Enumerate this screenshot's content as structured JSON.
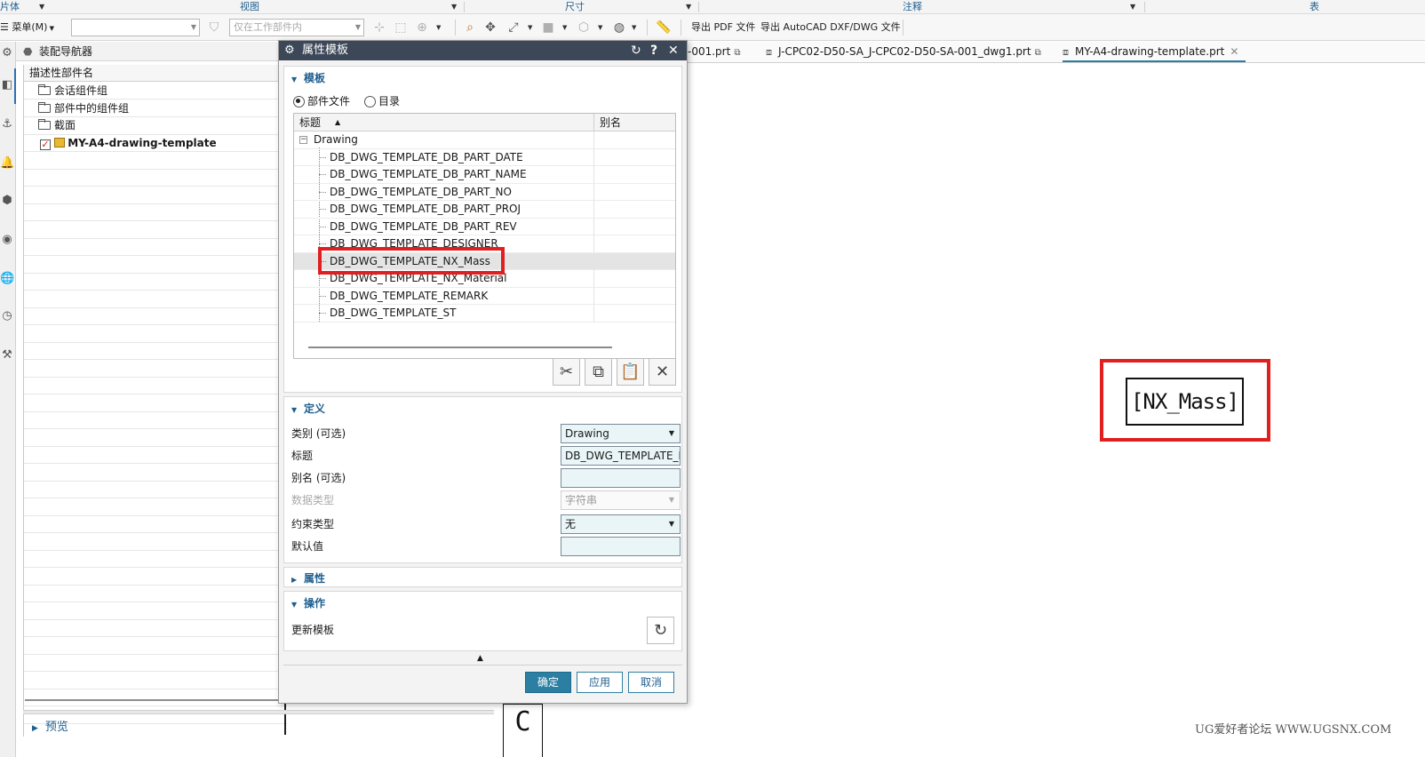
{
  "ribbon_groups": [
    {
      "label": "片体"
    },
    {
      "label": "视图"
    },
    {
      "label": "尺寸"
    },
    {
      "label": "注释"
    },
    {
      "label": "表"
    }
  ],
  "toolbar": {
    "menu_label": "菜单(M)",
    "combo1_value": "",
    "combo2_placeholder": "仅在工作部件内",
    "export_pdf": "导出 PDF 文件",
    "export_dwg": "导出 AutoCAD DXF/DWG 文件"
  },
  "navigator": {
    "title": "装配导航器",
    "column_header": "描述性部件名",
    "items": [
      {
        "label": "会话组件组"
      },
      {
        "label": "部件中的组件组"
      },
      {
        "label": "截面"
      },
      {
        "label": "MY-A4-drawing-template"
      }
    ],
    "preview_label": "预览"
  },
  "dialog": {
    "title": "属性模板",
    "sections": {
      "template": "模板",
      "definition": "定义",
      "attributes": "属性",
      "operations": "操作"
    },
    "radio_part_file": "部件文件",
    "radio_directory": "目录",
    "grid": {
      "col_title": "标题",
      "col_alias": "别名",
      "root": "Drawing",
      "rows": [
        "DB_DWG_TEMPLATE_DB_PART_DATE",
        "DB_DWG_TEMPLATE_DB_PART_NAME",
        "DB_DWG_TEMPLATE_DB_PART_NO",
        "DB_DWG_TEMPLATE_DB_PART_PROJ",
        "DB_DWG_TEMPLATE_DB_PART_REV",
        "DB_DWG_TEMPLATE_DESIGNER",
        "DB_DWG_TEMPLATE_NX_Mass",
        "DB_DWG_TEMPLATE_NX_Material",
        "DB_DWG_TEMPLATE_REMARK",
        "DB_DWG_TEMPLATE_ST"
      ],
      "selected_row": "DB_DWG_TEMPLATE_NX_Mass"
    },
    "fields": {
      "category_label": "类别 (可选)",
      "category_value": "Drawing",
      "title_label": "标题",
      "title_value": "DB_DWG_TEMPLATE_N",
      "alias_label": "别名 (可选)",
      "alias_value": "",
      "datatype_label": "数据类型",
      "datatype_value": "字符串",
      "constraint_label": "约束类型",
      "constraint_value": "无",
      "default_label": "默认值",
      "default_value": ""
    },
    "update_template_label": "更新模板",
    "buttons": {
      "ok": "确定",
      "apply": "应用",
      "cancel": "取消"
    }
  },
  "doc_tabs": [
    {
      "label": "-001.prt"
    },
    {
      "label": "J-CPC02-D50-SA_J-CPC02-D50-SA-001_dwg1.prt"
    },
    {
      "label": "MY-A4-drawing-template.prt",
      "active": true
    }
  ],
  "drawing": {
    "nx_mass_text": "[NX_Mass]",
    "cell_letter": "C",
    "watermark": "UG爱好者论坛 WWW.UGSNX.COM"
  },
  "colors": {
    "accent": "#2a7fa3",
    "title_bar": "#3c4757",
    "highlight_red": "#e02020",
    "section_text": "#1f5f8f"
  }
}
